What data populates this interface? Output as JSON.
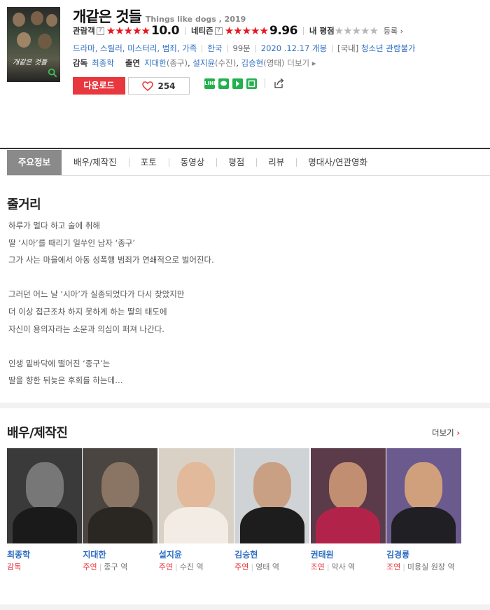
{
  "movie": {
    "title": "개같은 것들",
    "title_en": "Things like dogs , 2019",
    "poster_caption": "개같은 것들"
  },
  "ratings": {
    "audience_label": "관람객",
    "audience_stars": "★★★★★",
    "audience_score": "10.0",
    "netizen_label": "네티즌",
    "netizen_stars": "★★★★★",
    "netizen_score": "9.96",
    "my_label": "내 평점",
    "my_stars": "★★★★★",
    "register": "등록",
    "help_mark": "?"
  },
  "meta": {
    "genres": "드라마, 스릴러, 미스터리, 범죄, 가족",
    "country": "한국",
    "runtime": "99분",
    "release": "2020 .12.17 개봉",
    "rating_prefix": "[국내]",
    "rating": "청소년 관람불가"
  },
  "credits": {
    "director_label": "감독",
    "director": "최종학",
    "cast_label": "출연",
    "cast": [
      {
        "name": "지대한",
        "role": "(종구)"
      },
      {
        "name": "설지윤",
        "role": "(수진)"
      },
      {
        "name": "김승현",
        "role": "(영태)"
      }
    ],
    "more": "더보기"
  },
  "actions": {
    "download": "다운로드",
    "likes": "254",
    "share_icons": [
      "line-icon",
      "kakao-talk-icon",
      "band-icon",
      "sms-icon"
    ]
  },
  "tabs": [
    "주요정보",
    "배우/제작진",
    "포토",
    "동영상",
    "평점",
    "리뷰",
    "명대사/연관영화"
  ],
  "synopsis": {
    "title": "줄거리",
    "lines": [
      "하루가 멀다 하고 술에 취해",
      "딸 ‘시아’를 때리기 일쑤인 남자 ‘종구’",
      "그가 사는 마을에서 아동 성폭행 범죄가 연쇄적으로 벌어진다.",
      "",
      "그러던 어느 날 ‘시아’가 실종되었다가 다시 찾았지만",
      "더 이상 접근조차 하지 못하게 하는 딸의 태도에",
      "자신이 용의자라는 소문과 의심이 퍼져 나간다.",
      "",
      "인생 밑바닥에 떨어진 ‘종구’는",
      "딸을 향한 뒤늦은 후회를 하는데…"
    ]
  },
  "cast_section": {
    "title": "배우/제작진",
    "more": "더보기",
    "people": [
      {
        "name": "최종학",
        "type": "감독",
        "role": ""
      },
      {
        "name": "지대한",
        "type": "주연",
        "role": "종구 역"
      },
      {
        "name": "설지윤",
        "type": "주연",
        "role": "수진 역"
      },
      {
        "name": "김승현",
        "type": "주연",
        "role": "영태 역"
      },
      {
        "name": "권태원",
        "type": "조연",
        "role": "약사 역"
      },
      {
        "name": "김경룡",
        "type": "조연",
        "role": "미용실 원장 역"
      }
    ]
  },
  "colors": {
    "accent_red": "#e8373f",
    "star_red": "#e8171f",
    "link_blue": "#2e6ec2",
    "active_tab": "#8a8a8a"
  }
}
